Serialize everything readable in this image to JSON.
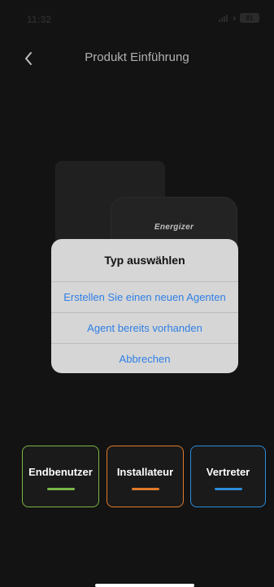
{
  "status_bar": {
    "time": "11:32",
    "battery": "81"
  },
  "nav": {
    "title": "Produkt Einführung",
    "back_icon": "chevron-left-icon"
  },
  "product": {
    "brand": "Energizer"
  },
  "dialog": {
    "title": "Typ auswählen",
    "options": [
      "Erstellen Sie einen neuen Agenten",
      "Agent bereits vorhanden",
      "Abbrechen"
    ]
  },
  "roles": [
    {
      "label": "Endbenutzer",
      "color": "#7ab648"
    },
    {
      "label": "Installateur",
      "color": "#e07a2a"
    },
    {
      "label": "Vertreter",
      "color": "#2d8cd8"
    }
  ],
  "colors": {
    "background": "#1a1a1a",
    "accent_blue": "#2f7fe6",
    "dialog_bg": "#d6d6d6"
  }
}
